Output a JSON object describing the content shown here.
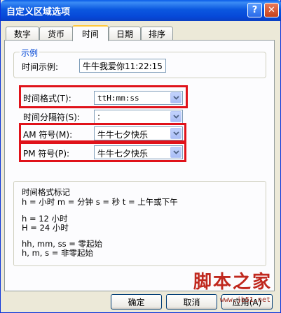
{
  "window": {
    "title": "自定义区域选项",
    "help_symbol": "?",
    "close_symbol": "✕"
  },
  "tabs": [
    {
      "label": "数字"
    },
    {
      "label": "货币"
    },
    {
      "label": "时间"
    },
    {
      "label": "日期"
    },
    {
      "label": "排序"
    }
  ],
  "sample": {
    "group_title": "示例",
    "label": "时间示例:",
    "value": "牛牛我爱你11:22:15"
  },
  "settings": {
    "time_format": {
      "label": "时间格式(T):",
      "value": "ttH:mm:ss"
    },
    "separator": {
      "label": "时间分隔符(S):",
      "value": ":"
    },
    "am_symbol": {
      "label": "AM 符号(M):",
      "value": "牛牛七夕快乐"
    },
    "pm_symbol": {
      "label": "PM 符号(P):",
      "value": "牛牛七夕快乐"
    }
  },
  "notation": {
    "title": "时间格式标记",
    "line1": "h = 小时    m = 分钟    s = 秒    t = 上午或下午",
    "line2": "h = 12 小时",
    "line3": "H = 24 小时",
    "line4": "hh, mm, ss = 零起始",
    "line5": "h, m, s = 非零起始"
  },
  "buttons": {
    "ok": "确定",
    "cancel": "取消",
    "apply": "应用(A)"
  },
  "watermark": {
    "text": "脚本之家",
    "url": "www.jb51.net"
  },
  "colors": {
    "highlight_border": "#e0121a",
    "title_bar": "#0b58e0",
    "group_title": "#0046d5"
  }
}
